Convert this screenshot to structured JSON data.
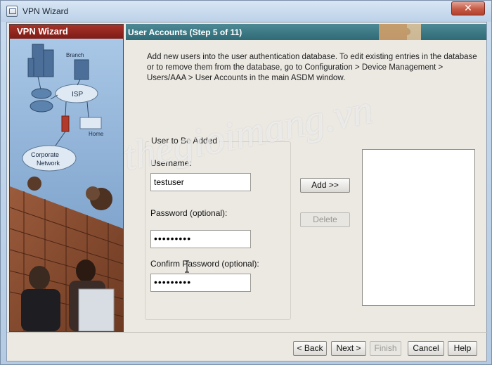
{
  "window": {
    "title": "VPN Wizard",
    "close_glyph": "✕"
  },
  "sidebar": {
    "header": "VPN Wizard",
    "labels": {
      "branch": "Branch",
      "isp": "ISP",
      "home": "Home",
      "corporate": "Corporate",
      "network": "Network"
    }
  },
  "step": {
    "title": "User Accounts  (Step 5 of 11)"
  },
  "main": {
    "description": "Add new users into the user authentication database. To edit existing entries in the database or to remove them from the database, go to Configuration > Device Management > Users/AAA > User Accounts in the main ASDM window.",
    "group_title": "User to Be Added",
    "username_label": "Username:",
    "username_value": "testuser",
    "password_label": "Password (optional):",
    "password_value": "•••••••••",
    "confirm_label": "Confirm Password (optional):",
    "confirm_value": "•••••••••",
    "add_label": "Add >>",
    "delete_label": "Delete"
  },
  "footer": {
    "back_label": "< Back",
    "next_label": "Next >",
    "finish_label": "Finish",
    "cancel_label": "Cancel",
    "help_label": "Help"
  },
  "watermark": "thegioimang.vn",
  "colors": {
    "side_header": "#8b231c",
    "step_bar": "#3c7985",
    "close_button": "#c75a45"
  }
}
